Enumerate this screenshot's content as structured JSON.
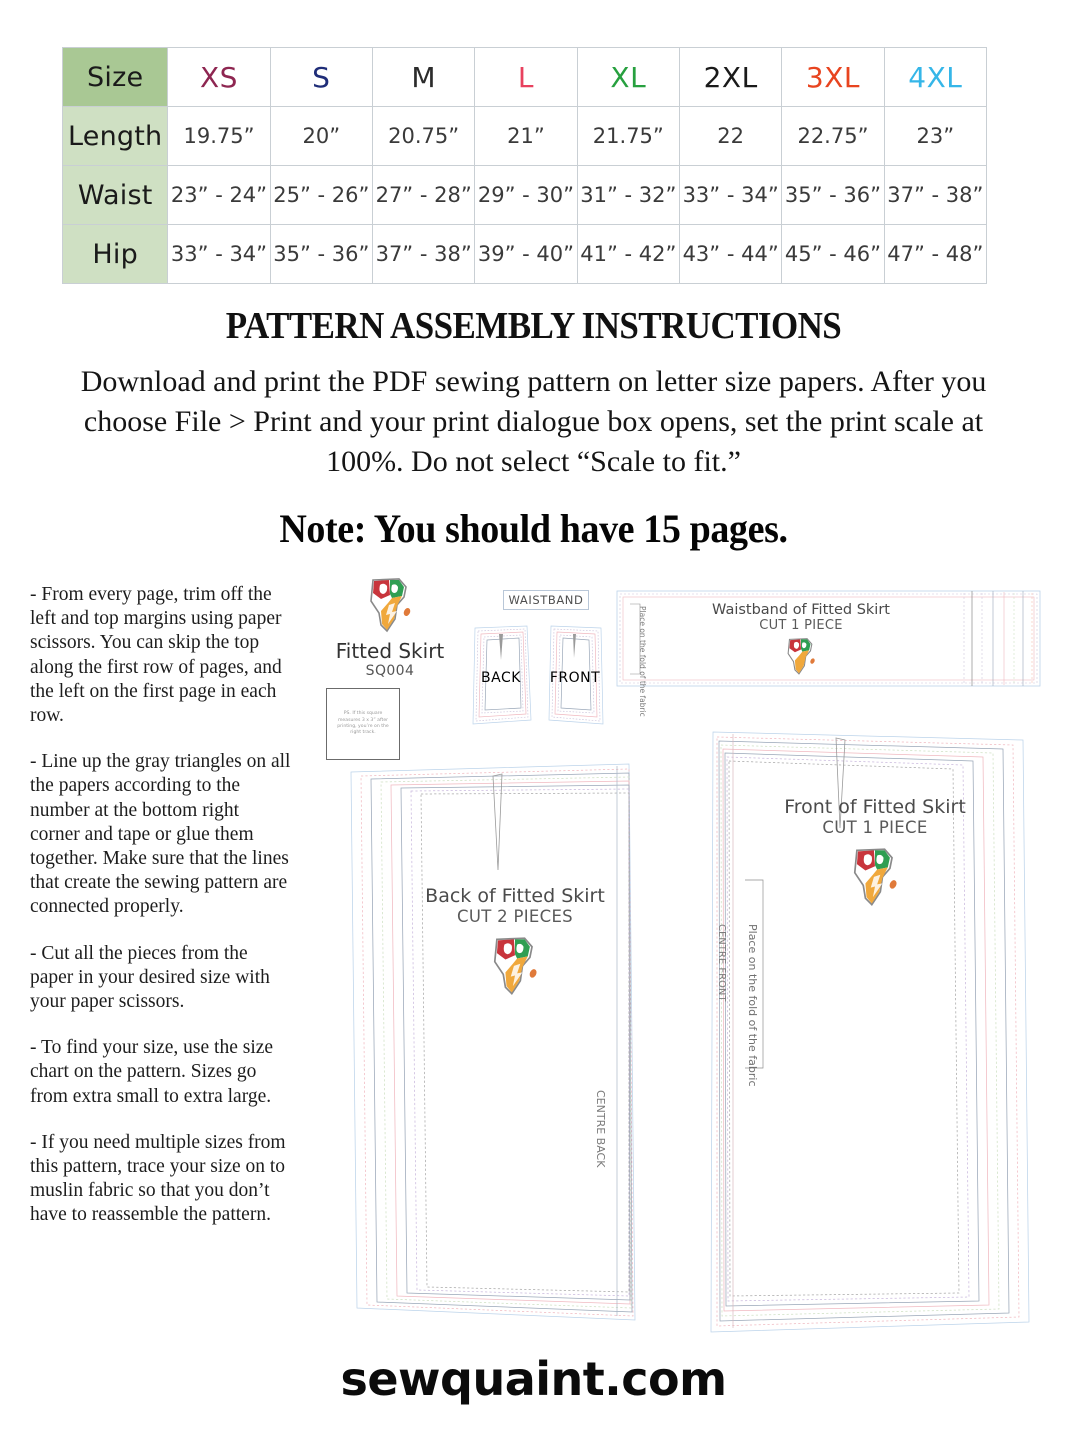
{
  "document": {
    "title": "PATTERN ASSEMBLY INSTRUCTIONS",
    "intro": "Download and print the PDF sewing pattern on letter size papers. After you choose File > Print and your print dialogue box opens, set the print scale at 100%. Do not select “Scale to fit.”",
    "note": "Note: You should have 15 pages.",
    "footer": "sewquaint.com"
  },
  "size_chart": {
    "corner_label": "Size",
    "sizes": [
      {
        "label": "XS",
        "color": "#8e2651"
      },
      {
        "label": "S",
        "color": "#1f2d78"
      },
      {
        "label": "M",
        "color": "#2b2b2b"
      },
      {
        "label": "L",
        "color": "#e8415e"
      },
      {
        "label": "XL",
        "color": "#27a03f"
      },
      {
        "label": "2XL",
        "color": "#1a1a1a"
      },
      {
        "label": "3XL",
        "color": "#e8441f"
      },
      {
        "label": "4XL",
        "color": "#35b6e8"
      }
    ],
    "rows": [
      {
        "label": "Length",
        "values": [
          "19.75”",
          "20”",
          "20.75”",
          "21”",
          "21.75”",
          "22",
          "22.75”",
          "23”"
        ]
      },
      {
        "label": "Waist",
        "values": [
          "23” - 24”",
          "25” - 26”",
          "27” - 28”",
          "29” - 30”",
          "31” - 32”",
          "33” - 34”",
          "35” - 36”",
          "37” - 38”"
        ]
      },
      {
        "label": "Hip",
        "values": [
          "33” - 34”",
          "35” - 36”",
          "37” - 38”",
          "39” - 40”",
          "41” - 42”",
          "43” - 44”",
          "45” - 46”",
          "47” - 48”"
        ]
      }
    ]
  },
  "steps": [
    "- From every page, trim off the left and top margins using paper scissors. You can skip the top along the first row of pages, and the left on the first page in each row.",
    "- Line up the gray triangles on all the papers according to the number at the bottom right corner and tape or glue them together. Make sure that the lines that create the sewing pattern are connected properly.",
    "- Cut all the pieces from the paper in your desired size with your paper scissors.",
    "- To find your size, use the size chart on the pattern. Sizes go from extra small to extra large.",
    "- If you need multiple sizes from this pattern, trace your size on to muslin fabric so that you don’t have to reassemble the pattern."
  ],
  "diagram": {
    "brand_name": "Fitted Skirt",
    "brand_code": "SQ004",
    "test_square_text": "PS. If this square measures 3 x 3” after printing, you’re on the right track.",
    "waistband_tag": "WAISTBAND",
    "mini_back_label": "BACK",
    "mini_front_label": "FRONT",
    "waistband_piece": {
      "title": "Waistband of Fitted Skirt",
      "subtitle": "CUT 1 PIECE",
      "fold_text": "Place on the fold of the fabric"
    },
    "back_piece": {
      "title": "Back of Fitted Skirt",
      "subtitle": "CUT 2 PIECES",
      "centre_text": "CENTRE BACK"
    },
    "front_piece": {
      "title": "Front of Fitted Skirt",
      "subtitle": "CUT 1 PIECE",
      "centre_text": "CENTRE FRONT",
      "fold_text": "Place on the fold of the fabric"
    }
  }
}
